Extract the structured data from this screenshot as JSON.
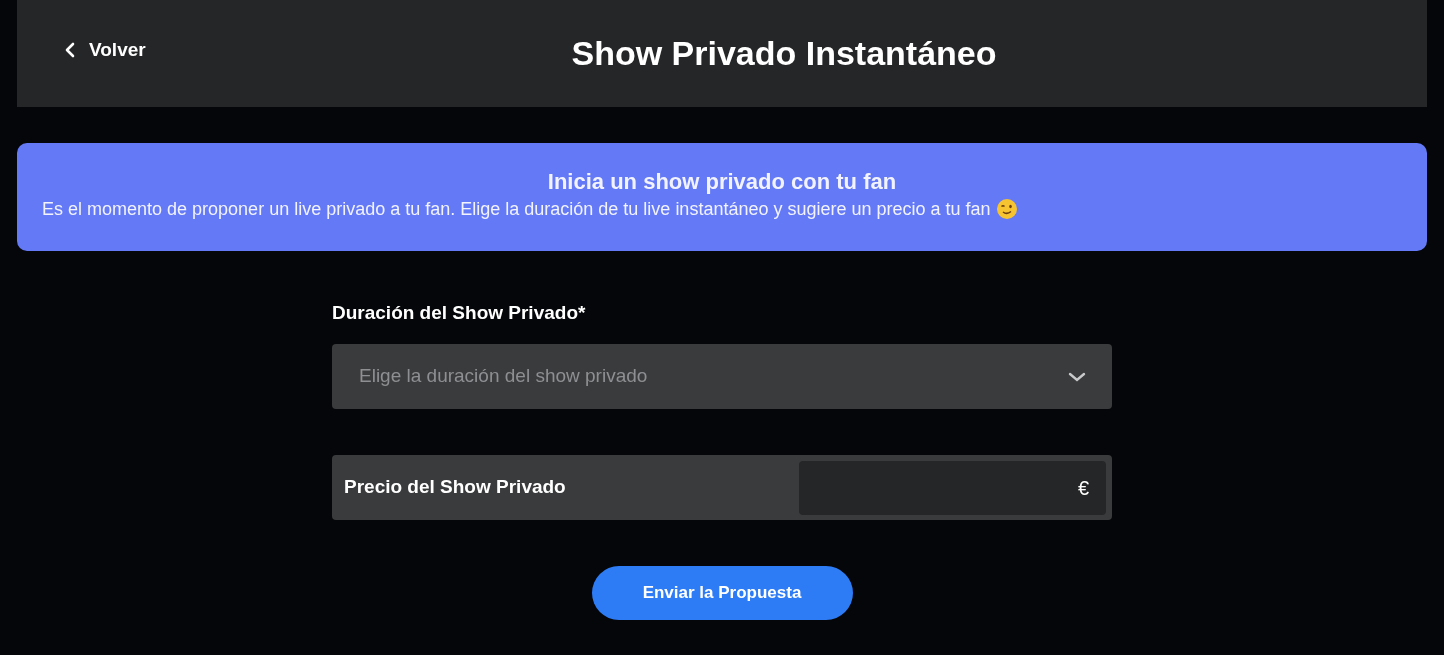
{
  "header": {
    "back_label": "Volver",
    "title": "Show Privado Instantáneo"
  },
  "banner": {
    "title": "Inicia un show privado con tu fan",
    "text": "Es el momento de proponer un live privado a tu fan. Elige la duración de tu live instantáneo y sugiere un precio a tu fan"
  },
  "duration": {
    "label": "Duración del Show Privado*",
    "placeholder": "Elige la duración del show privado"
  },
  "price": {
    "label": "Precio del Show Privado",
    "currency": "€"
  },
  "submit": "Enviar la Propuesta"
}
